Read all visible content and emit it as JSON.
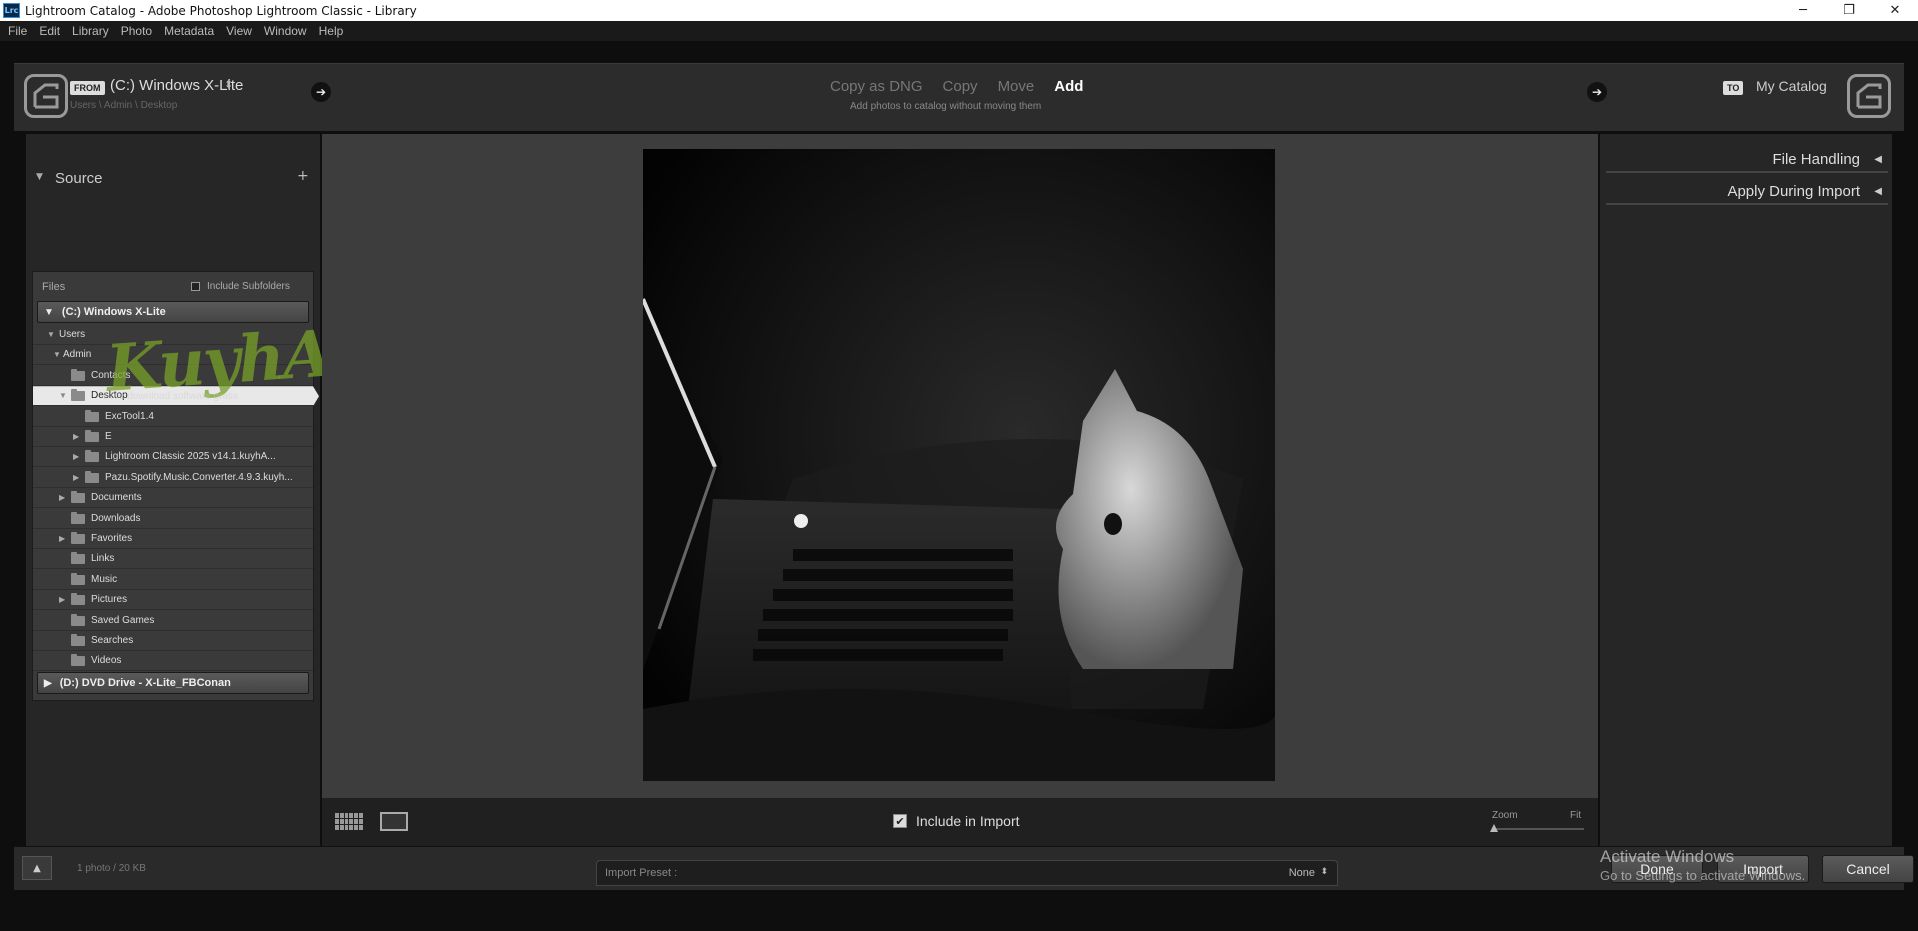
{
  "window": {
    "title": "Lightroom Catalog - Adobe Photoshop Lightroom Classic - Library",
    "app_badge": "Lrc",
    "controls": {
      "minimize": "─",
      "maximize": "❐",
      "close": "✕"
    }
  },
  "menu": [
    "File",
    "Edit",
    "Library",
    "Photo",
    "Metadata",
    "View",
    "Window",
    "Help"
  ],
  "import": {
    "from_tag": "FROM",
    "source_name": "(C:) Windows X-Lite",
    "source_chevron": "⬍",
    "source_path": "Users \\ Admin \\ Desktop",
    "modes": [
      "Copy as DNG",
      "Copy",
      "Move",
      "Add"
    ],
    "active_mode": "Add",
    "mode_description": "Add photos to catalog without moving them",
    "to_tag": "TO",
    "destination": "My Catalog",
    "arrow": "➔"
  },
  "source_panel": {
    "title": "Source",
    "add_icon": "+",
    "files_label": "Files",
    "include_subfolders": "Include Subfolders",
    "volume_c": "(C:) Windows X-Lite",
    "volume_d": "(D:) DVD Drive - X-Lite_FBConan",
    "tree": [
      {
        "label": "Users",
        "level": 1,
        "expanded": true,
        "folder": false
      },
      {
        "label": "Admin",
        "level": 2,
        "expanded": true,
        "folder": false
      },
      {
        "label": "Contacts",
        "level": 3,
        "folder": true
      },
      {
        "label": "Desktop",
        "level": 3,
        "folder": true,
        "selected": true,
        "expanded": true
      },
      {
        "label": "ExcTool1.4",
        "level": 4,
        "folder": true
      },
      {
        "label": "E",
        "level": 4,
        "folder": true,
        "has_children": true
      },
      {
        "label": "Lightroom Classic 2025 v14.1.kuyhA...",
        "level": 4,
        "folder": true,
        "has_children": true
      },
      {
        "label": "Pazu.Spotify.Music.Converter.4.9.3.kuyh...",
        "level": 4,
        "folder": true,
        "has_children": true
      },
      {
        "label": "Documents",
        "level": 3,
        "folder": true,
        "has_children": true
      },
      {
        "label": "Downloads",
        "level": 3,
        "folder": true
      },
      {
        "label": "Favorites",
        "level": 3,
        "folder": true,
        "has_children": true
      },
      {
        "label": "Links",
        "level": 3,
        "folder": true
      },
      {
        "label": "Music",
        "level": 3,
        "folder": true
      },
      {
        "label": "Pictures",
        "level": 3,
        "folder": true,
        "has_children": true
      },
      {
        "label": "Saved Games",
        "level": 3,
        "folder": true
      },
      {
        "label": "Searches",
        "level": 3,
        "folder": true
      },
      {
        "label": "Videos",
        "level": 3,
        "folder": true
      }
    ]
  },
  "right_panel": {
    "sections": [
      "File Handling",
      "Apply During Import"
    ],
    "collapse_icon": "◀"
  },
  "toolbar": {
    "include_in_import": "Include in Import",
    "zoom_label": "Zoom",
    "fit_label": "Fit"
  },
  "footer": {
    "photo_count": "1 photo / 20 KB",
    "import_preset_label": "Import Preset :",
    "import_preset_value": "None",
    "preset_chevron": "⬍",
    "done": "Done",
    "import_btn": "Import",
    "cancel": "Cancel",
    "up_icon": "▲"
  },
  "watermark": {
    "brand": "KuyhAaMe",
    "tagline": "Free download software gratis"
  },
  "activation": {
    "title": "Activate Windows",
    "subtitle": "Go to Settings to activate Windows."
  }
}
